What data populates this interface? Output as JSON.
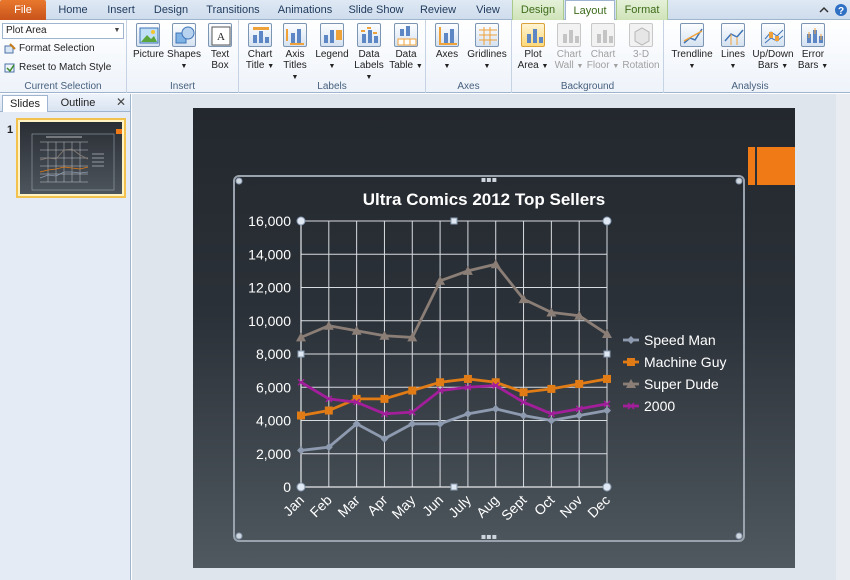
{
  "tabs": [
    {
      "label": "File",
      "style": "file"
    },
    {
      "label": "Home"
    },
    {
      "label": "Insert"
    },
    {
      "label": "Design"
    },
    {
      "label": "Transitions"
    },
    {
      "label": "Animations"
    },
    {
      "label": "Slide Show"
    },
    {
      "label": "Review"
    },
    {
      "label": "View"
    },
    {
      "label": "Design",
      "style": "ctx"
    },
    {
      "label": "Layout",
      "style": "active"
    },
    {
      "label": "Format",
      "style": "ctx"
    }
  ],
  "ribbon": {
    "current_selection": {
      "combo_value": "Plot Area",
      "format_selection": "Format Selection",
      "reset_match": "Reset to Match Style",
      "group_label": "Current Selection"
    },
    "insert": {
      "picture": "Picture",
      "shapes": "Shapes",
      "text_box_1": "Text",
      "text_box_2": "Box",
      "group_label": "Insert"
    },
    "labels": {
      "chart_title_1": "Chart",
      "chart_title_2": "Title",
      "axis_titles_1": "Axis",
      "axis_titles_2": "Titles",
      "legend": "Legend",
      "data_labels_1": "Data",
      "data_labels_2": "Labels",
      "data_table_1": "Data",
      "data_table_2": "Table",
      "group_label": "Labels"
    },
    "axes": {
      "axes": "Axes",
      "gridlines": "Gridlines",
      "group_label": "Axes"
    },
    "background": {
      "plot_area_1": "Plot",
      "plot_area_2": "Area",
      "chart_wall_1": "Chart",
      "chart_wall_2": "Wall",
      "chart_floor_1": "Chart",
      "chart_floor_2": "Floor",
      "rotation_1": "3-D",
      "rotation_2": "Rotation",
      "group_label": "Background"
    },
    "analysis": {
      "trendline": "Trendline",
      "lines": "Lines",
      "updown_1": "Up/Down",
      "updown_2": "Bars",
      "error_1": "Error",
      "error_2": "Bars",
      "group_label": "Analysis"
    }
  },
  "left_pane": {
    "tab_slides": "Slides",
    "tab_outline": "Outline",
    "close": "✕",
    "slide_number": "1"
  },
  "colors": {
    "accent_orange": "#f07a16",
    "speed_man": "#8e9aaf",
    "machine_guy": "#e07b15",
    "super_dude": "#8a7e76",
    "y2000": "#a21e9a"
  },
  "chart_data": {
    "type": "line",
    "title": "Ultra Comics 2012 Top Sellers",
    "categories": [
      "Jan",
      "Feb",
      "Mar",
      "Apr",
      "May",
      "Jun",
      "July",
      "Aug",
      "Sept",
      "Oct",
      "Nov",
      "Dec"
    ],
    "ylim": [
      0,
      16000
    ],
    "yticks": [
      0,
      2000,
      4000,
      6000,
      8000,
      10000,
      12000,
      14000,
      16000
    ],
    "ytick_labels": [
      "0",
      "2,000",
      "4,000",
      "6,000",
      "8,000",
      "10,000",
      "12,000",
      "14,000",
      "16,000"
    ],
    "grid": "horizontal and vertical",
    "legend_position": "right",
    "series": [
      {
        "name": "Speed Man",
        "marker": "diamond",
        "color": "#8e9aaf",
        "values": [
          2200,
          2400,
          3800,
          2900,
          3800,
          3800,
          4400,
          4700,
          4300,
          4000,
          4300,
          4600
        ]
      },
      {
        "name": "Machine Guy",
        "marker": "square",
        "color": "#e07b15",
        "values": [
          4300,
          4600,
          5300,
          5300,
          5800,
          6300,
          6500,
          6300,
          5700,
          5900,
          6200,
          6500
        ]
      },
      {
        "name": "Super Dude",
        "marker": "triangle",
        "color": "#8a7e76",
        "values": [
          9000,
          9700,
          9400,
          9100,
          9000,
          12400,
          13000,
          13400,
          11300,
          10500,
          10300,
          9200
        ]
      },
      {
        "name": "2000",
        "marker": "x",
        "color": "#a21e9a",
        "values": [
          6300,
          5300,
          5100,
          4400,
          4500,
          5800,
          6000,
          6100,
          5100,
          4400,
          4700,
          5000
        ]
      }
    ]
  }
}
